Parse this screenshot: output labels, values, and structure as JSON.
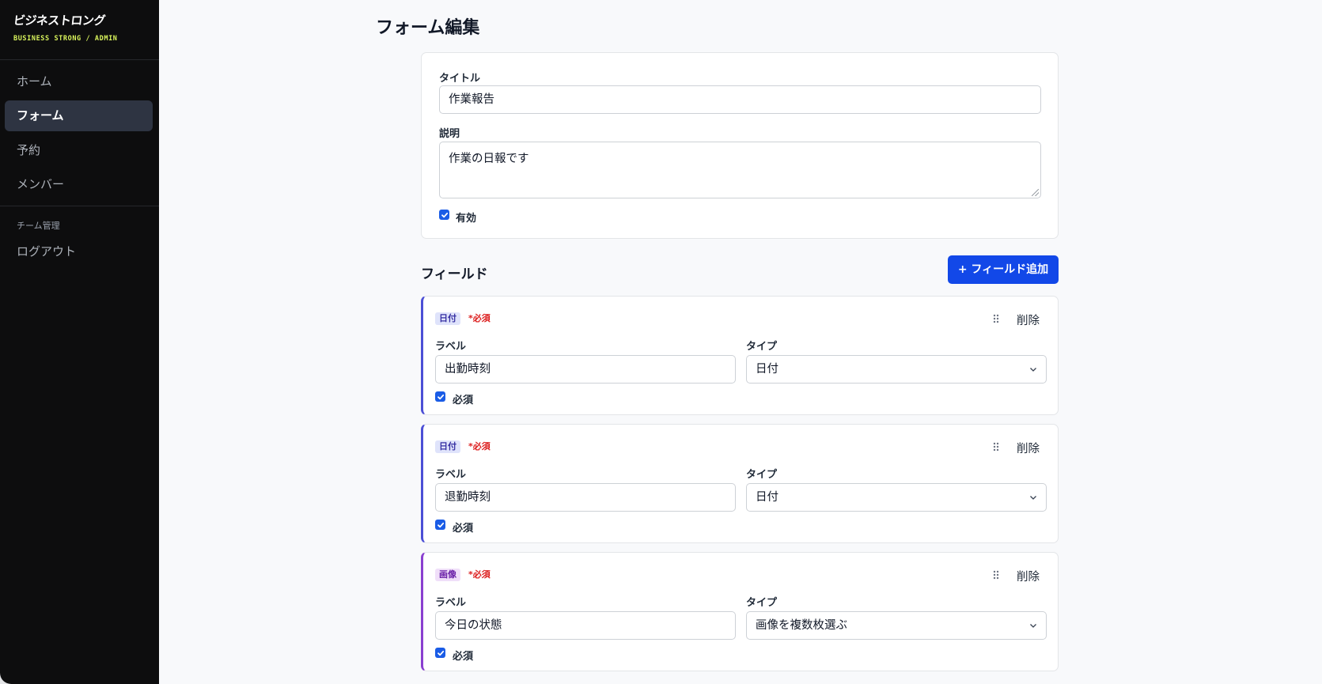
{
  "brand": {
    "logo": "ビジネストロング",
    "subtitle": "BUSINESS STRONG / ADMIN"
  },
  "sidebar": {
    "items": [
      {
        "label": "ホーム",
        "active": false
      },
      {
        "label": "フォーム",
        "active": true
      },
      {
        "label": "予約",
        "active": false
      },
      {
        "label": "メンバー",
        "active": false
      }
    ],
    "section_label": "チーム管理",
    "logout_label": "ログアウト"
  },
  "page": {
    "title": "フォーム編集"
  },
  "form": {
    "title_label": "タイトル",
    "title_value": "作業報告",
    "description_label": "説明",
    "description_value": "作業の日報です",
    "enabled_label": "有効",
    "enabled": true
  },
  "fields_section": {
    "title": "フィールド",
    "add_button": "+ フィールド追加"
  },
  "fields": [
    {
      "badge": "日付",
      "required_tag": "*必須",
      "drag_icon": "drag-handle-icon",
      "delete_label": "削除",
      "label_caption": "ラベル",
      "label_value": "出勤時刻",
      "type_caption": "タイプ",
      "type_value": "日付",
      "required_label": "必須",
      "required": true
    },
    {
      "badge": "日付",
      "required_tag": "*必須",
      "drag_icon": "drag-handle-icon",
      "delete_label": "削除",
      "label_caption": "ラベル",
      "label_value": "退勤時刻",
      "type_caption": "タイプ",
      "type_value": "日付",
      "required_label": "必須",
      "required": true
    },
    {
      "badge": "画像",
      "required_tag": "*必須",
      "drag_icon": "drag-handle-icon",
      "delete_label": "削除",
      "label_caption": "ラベル",
      "label_value": "今日の状態",
      "type_caption": "タイプ",
      "type_value": "画像を複数枚選ぶ",
      "required_label": "必須",
      "required": true
    }
  ],
  "colors": {
    "primary": "#1248e8",
    "sidebar_bg": "#0d0d0e",
    "brand_accent": "#d9f45c",
    "required_red": "#dc1c1c",
    "date_accent": "#4c4fd6",
    "image_accent": "#8a3fd0"
  }
}
